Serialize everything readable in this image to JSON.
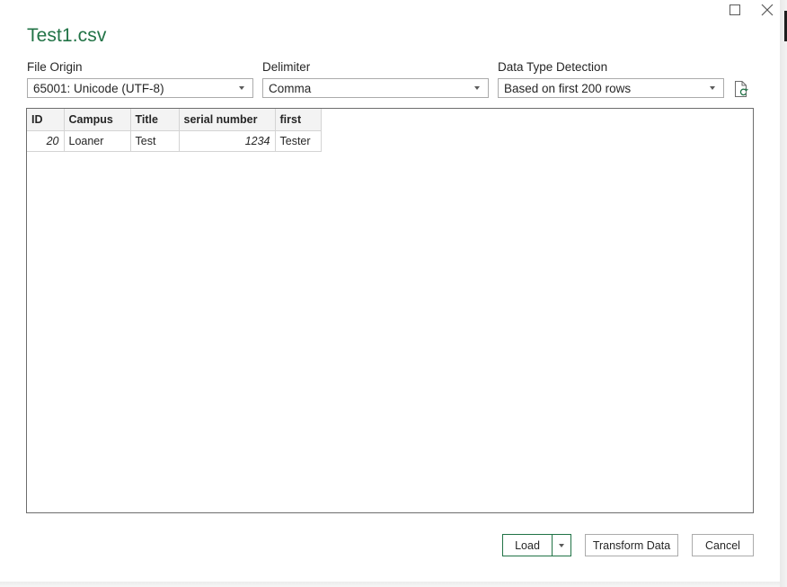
{
  "window": {
    "title": "Test1.csv",
    "maximize_icon": "maximize-icon",
    "close_icon": "close-icon"
  },
  "options": {
    "file_origin": {
      "label": "File Origin",
      "value": "65001: Unicode (UTF-8)"
    },
    "delimiter": {
      "label": "Delimiter",
      "value": "Comma"
    },
    "data_type_detection": {
      "label": "Data Type Detection",
      "value": "Based on first 200 rows"
    },
    "refresh_icon": "refresh-document-icon"
  },
  "preview": {
    "columns": [
      "ID",
      "Campus",
      "Title",
      "serial number",
      "first"
    ],
    "rows": [
      [
        "20",
        "Loaner",
        "Test",
        "1234",
        "Tester"
      ]
    ]
  },
  "buttons": {
    "load": "Load",
    "transform": "Transform Data",
    "cancel": "Cancel"
  },
  "colors": {
    "accent": "#217346"
  }
}
